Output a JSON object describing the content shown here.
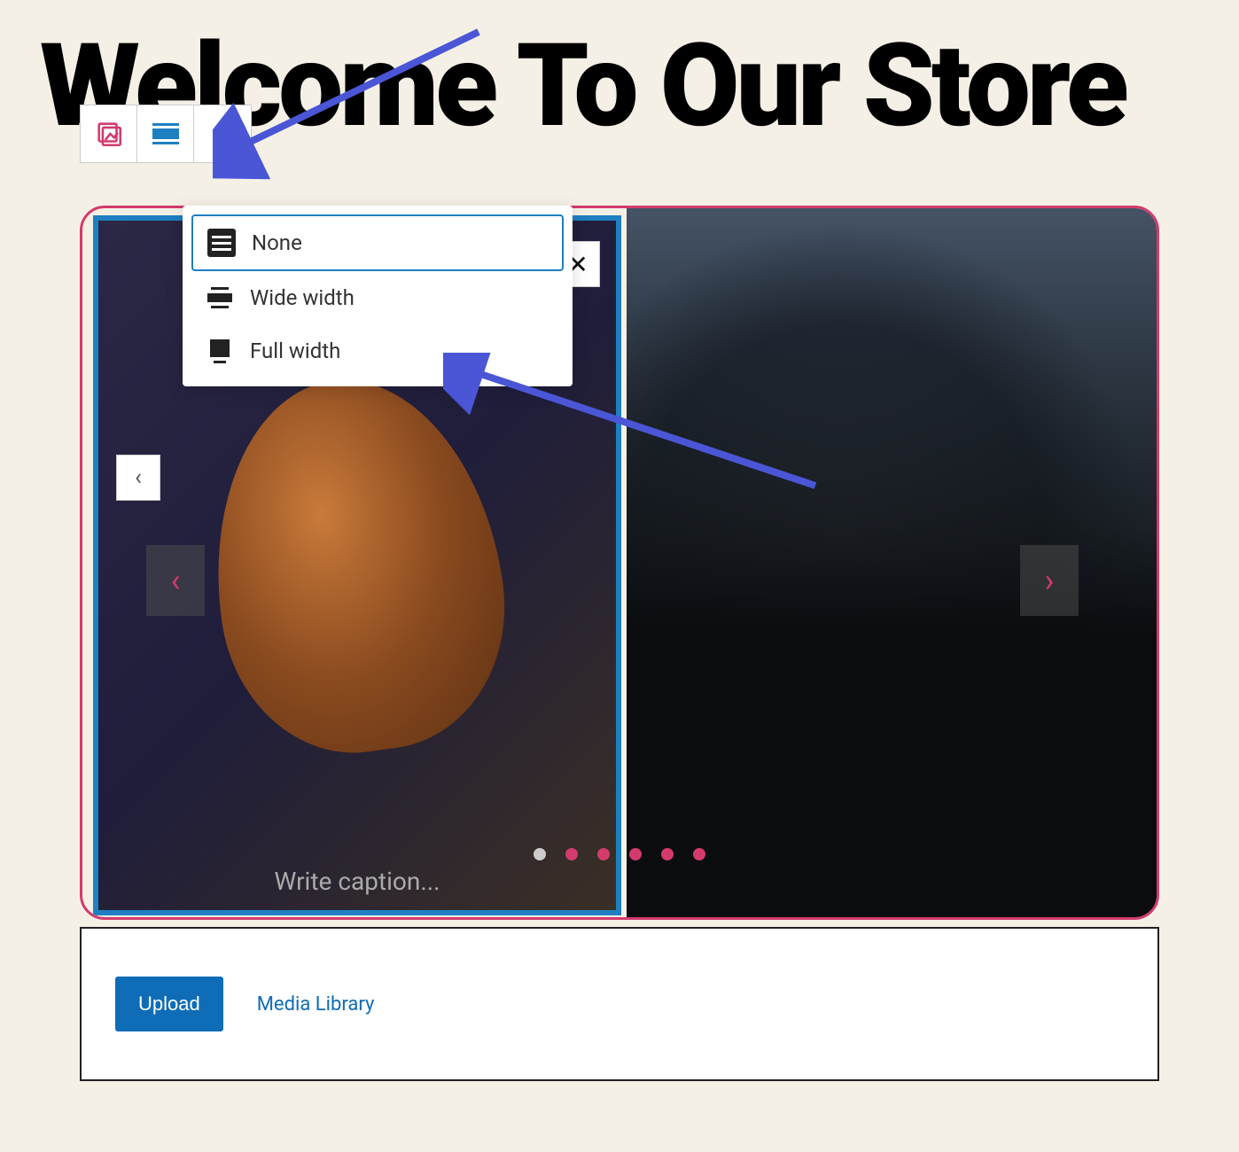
{
  "page": {
    "title": "Welcome To Our Store"
  },
  "toolbar": {
    "media_icon": "gallery-block-icon",
    "align_icon": "alignment-icon",
    "more_icon": "more-options-icon"
  },
  "alignment_menu": {
    "items": [
      {
        "label": "None",
        "selected": true
      },
      {
        "label": "Wide width",
        "selected": false
      },
      {
        "label": "Full width",
        "selected": false
      }
    ]
  },
  "carousel": {
    "prev_label": "‹",
    "next_label": "›",
    "close_label": "✕",
    "arrow_left": "‹",
    "arrow_right": "›",
    "caption_placeholder": "Write caption...",
    "dots_count": 6,
    "active_dot_index": 0
  },
  "media_panel": {
    "upload_label": "Upload",
    "media_library_label": "Media Library"
  }
}
